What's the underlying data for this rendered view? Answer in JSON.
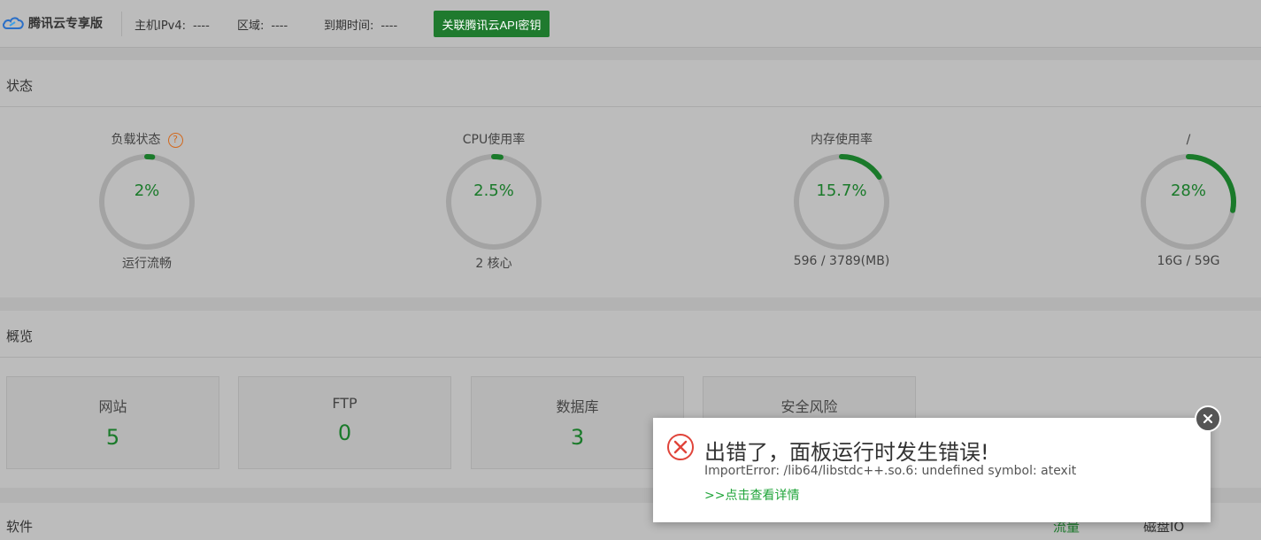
{
  "header": {
    "logo_text": "腾讯云专享版",
    "host_label": "主机IPv4:",
    "host_value": "----",
    "region_label": "区域:",
    "region_value": "----",
    "expire_label": "到期时间:",
    "expire_value": "----",
    "api_button": "关联腾讯云API密钥"
  },
  "status_panel": {
    "title": "状态",
    "gauges": [
      {
        "label": "负载状态",
        "value": "2%",
        "percent": 2,
        "sub": "运行流畅",
        "help": "?"
      },
      {
        "label": "CPU使用率",
        "value": "2.5%",
        "percent": 2.5,
        "sub": "2 核心"
      },
      {
        "label": "内存使用率",
        "value": "15.7%",
        "percent": 15.7,
        "sub": "596 / 3789(MB)"
      },
      {
        "label": "/",
        "value": "28%",
        "percent": 28,
        "sub": "16G / 59G"
      }
    ]
  },
  "overview_panel": {
    "title": "概览",
    "stats": [
      {
        "label": "网站",
        "value": "5"
      },
      {
        "label": "FTP",
        "value": "0"
      },
      {
        "label": "数据库",
        "value": "3"
      },
      {
        "label": "安全风险",
        "value": ""
      }
    ]
  },
  "software_panel": {
    "title": "软件"
  },
  "traffic_tabs": {
    "flow": "流量",
    "disk": "磁盘IO"
  },
  "error_dialog": {
    "title": "出错了，面板运行时发生错误!",
    "message": "ImportError: /lib64/libstdc++.so.6: undefined symbol: atexit",
    "link": ">>点击查看详情"
  },
  "colors": {
    "accent_green": "#1a7a2a",
    "button_green": "#1f7a2e",
    "link_green": "#20a53a",
    "error_red": "#e0443a"
  }
}
